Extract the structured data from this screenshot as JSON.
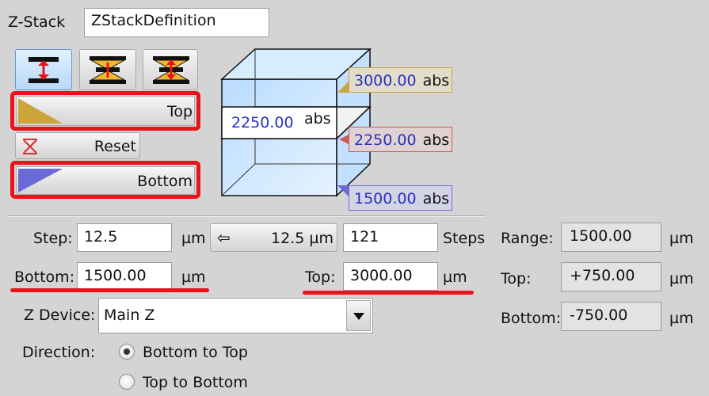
{
  "header": {
    "zstack_label": "Z-Stack",
    "name_value": "ZStackDefinition"
  },
  "mode_icons": [
    "range-mode-icon",
    "center-mode-icon",
    "offset-mode-icon"
  ],
  "buttons": {
    "top_label": "Top",
    "reset_label": "Reset",
    "bottom_label": "Bottom"
  },
  "preview": {
    "center_value": "2250.00",
    "center_unit": "abs",
    "markers": {
      "top": {
        "value": "3000.00",
        "unit": "abs"
      },
      "center": {
        "value": "2250.00",
        "unit": "abs"
      },
      "bottom": {
        "value": "1500.00",
        "unit": "abs"
      }
    }
  },
  "params": {
    "step_label": "Step:",
    "step_value": "12.5",
    "step_unit": "µm",
    "apply_step_button": "12.5 µm",
    "steps_value": "121",
    "steps_label": "Steps",
    "bottom_label": "Bottom:",
    "bottom_value": "1500.00",
    "bottom_unit": "µm",
    "top_label": "Top:",
    "top_value": "3000.00",
    "top_unit": "µm"
  },
  "range_panel": {
    "range_label": "Range:",
    "range_value": "1500.00",
    "range_unit": "µm",
    "top_label": "Top:",
    "top_value": "+750.00",
    "top_unit": "µm",
    "bottom_label": "Bottom:",
    "bottom_value": "-750.00",
    "bottom_unit": "µm"
  },
  "device": {
    "label": "Z Device:",
    "selected": "Main Z"
  },
  "direction": {
    "label": "Direction:",
    "options": [
      {
        "label": "Bottom to Top",
        "checked": true
      },
      {
        "label": "Top to Bottom",
        "checked": false
      }
    ]
  },
  "colors": {
    "highlight_red": "#e8141b",
    "top_marker": "#c9a53a",
    "center_marker": "#cc5a5a",
    "bottom_marker": "#6a6ad6",
    "value_text": "#2630c0"
  }
}
